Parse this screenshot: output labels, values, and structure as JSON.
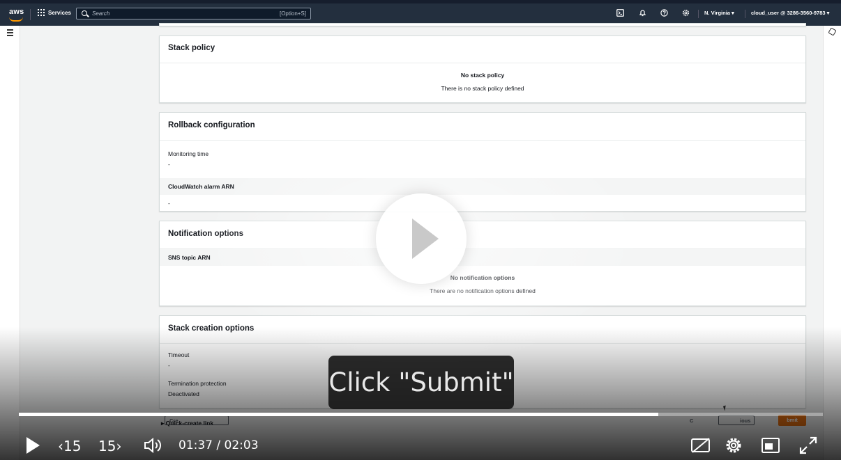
{
  "topbar": {
    "logo": "aws",
    "services_label": "Services",
    "search_placeholder": "Search",
    "search_shortcut": "[Option+S]",
    "region": "N. Virginia ▾",
    "account": "cloud_user @ 3286-3560-9783 ▾"
  },
  "stack_policy": {
    "title": "Stack policy",
    "empty_title": "No stack policy",
    "empty_desc": "There is no stack policy defined"
  },
  "rollback": {
    "title": "Rollback configuration",
    "monitoring_label": "Monitoring time",
    "monitoring_value": "-",
    "alarm_label": "CloudWatch alarm ARN",
    "alarm_value": "-"
  },
  "notifications": {
    "title": "Notification options",
    "sns_label": "SNS topic ARN",
    "empty_title": "No notification options",
    "empty_desc": "There are no notification options defined"
  },
  "creation": {
    "title": "Stack creation options",
    "timeout_label": "Timeout",
    "timeout_value": "-",
    "termination_label": "Termination protection",
    "termination_value": "Deactivated"
  },
  "footer": {
    "quick_create": "Quick-create link",
    "create_change_set_partial": "Cre",
    "cancel_partial": "C",
    "previous_partial": "ious",
    "submit_partial": "bmit"
  },
  "video": {
    "caption": "Click \"Submit\"",
    "skip_back": "‹15",
    "skip_forward": "15›",
    "time": "01:37 / 02:03",
    "progress": 0.795
  }
}
